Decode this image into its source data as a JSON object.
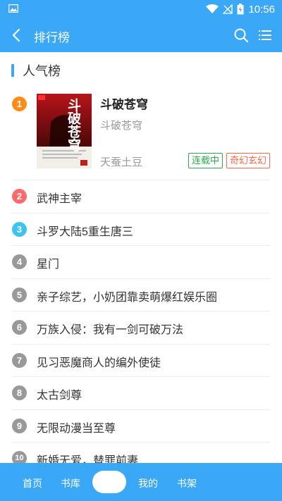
{
  "status_bar": {
    "time": "10:56",
    "icons": [
      "image-icon",
      "wifi-icon",
      "no-signal-icon",
      "battery-icon"
    ]
  },
  "app_bar": {
    "title": "排行榜",
    "icons": [
      "back-icon",
      "search-icon",
      "list-menu-icon"
    ]
  },
  "section": {
    "title": "人气榜"
  },
  "top_book": {
    "rank": "1",
    "rank_color": "#ff8c1a",
    "title": "斗破苍穹",
    "subtitle": "斗破苍穹",
    "author": "天蚕土豆",
    "status_tag": "连载中",
    "genre_tag": "奇幻玄幻",
    "cover_text": "斗破苍穹"
  },
  "rank_list": [
    {
      "rank": "2",
      "title": "武神主宰",
      "color": "#ff6b6b"
    },
    {
      "rank": "3",
      "title": "斗罗大陆5重生唐三",
      "color": "#3cc3f0"
    },
    {
      "rank": "4",
      "title": "星门",
      "color": "#999999"
    },
    {
      "rank": "5",
      "title": "亲子综艺，小奶团靠卖萌爆红娱乐圈",
      "color": "#999999"
    },
    {
      "rank": "6",
      "title": "万族入侵：我有一剑可破万法",
      "color": "#999999"
    },
    {
      "rank": "7",
      "title": "见习恶魔商人的编外使徒",
      "color": "#999999"
    },
    {
      "rank": "8",
      "title": "太古剑尊",
      "color": "#999999"
    },
    {
      "rank": "9",
      "title": "无限动漫当至尊",
      "color": "#999999"
    },
    {
      "rank": "10",
      "title": "新婚无爱，替罪前妻",
      "color": "#999999"
    }
  ],
  "bottom_nav": {
    "home": "首页",
    "library": "书库",
    "mine": "我的",
    "shelf": "书架"
  },
  "colors": {
    "primary": "#3aa7f7"
  }
}
